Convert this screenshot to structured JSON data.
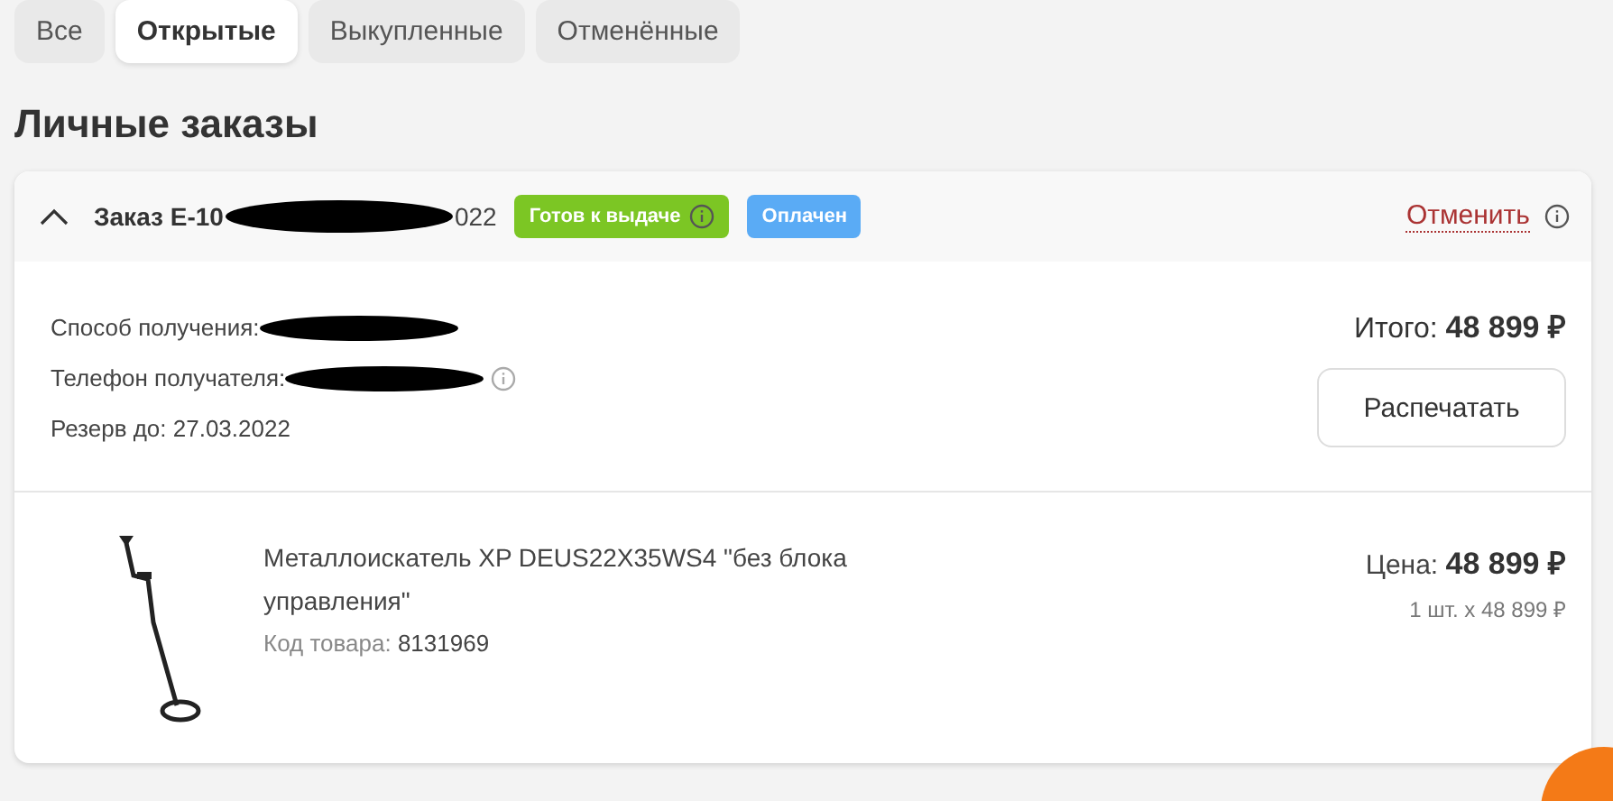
{
  "tabs": [
    {
      "label": "Все",
      "selected": false
    },
    {
      "label": "Открытые",
      "selected": true
    },
    {
      "label": "Выкупленные",
      "selected": false
    },
    {
      "label": "Отменённые",
      "selected": false
    }
  ],
  "title": "Личные заказы",
  "order": {
    "expanded": true,
    "number_start": "Заказ Е-10",
    "number_end": "022",
    "badges": [
      {
        "label": "Готов к выдаче",
        "color": "#7cc624",
        "info": true
      },
      {
        "label": "Оплачен",
        "color": "#5aabf5",
        "info": false
      }
    ],
    "cancel_link": "Отменить",
    "details": [
      {
        "kind": "redacted",
        "label": "Способ получения:",
        "info": false
      },
      {
        "kind": "redacted",
        "label": "Телефон получателя:",
        "info": true
      },
      {
        "kind": "text",
        "label": "Резерв до: 27.03.2022",
        "info": false
      }
    ],
    "total_label": "Итого:",
    "total_value": "48 899 ₽",
    "print_button": "Распечатать",
    "items": [
      {
        "name": "Металлоискатель XP DEUS22X35WS4 \"без блока управления\"",
        "code_label": "Код товара:",
        "code": "8131969",
        "price_label": "Цена:",
        "price": "48 899 ₽",
        "quantity": "1 шт. x 48 899 ₽"
      }
    ]
  }
}
